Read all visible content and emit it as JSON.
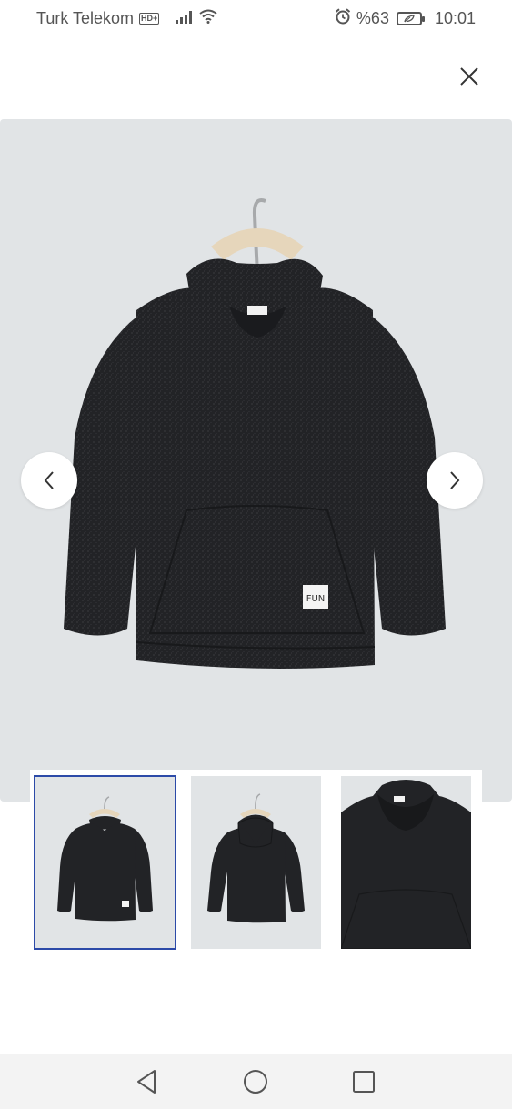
{
  "status_bar": {
    "carrier": "Turk Telekom",
    "hd_badge": "HD+",
    "battery_percent": "%63",
    "time": "10:01"
  },
  "header": {
    "close_icon": "close-icon"
  },
  "gallery": {
    "main_image": "product-photo-front",
    "patch_text": "FUN",
    "prev_icon": "chevron-left-icon",
    "next_icon": "chevron-right-icon",
    "thumbnails": [
      {
        "name": "front-view",
        "active": true
      },
      {
        "name": "back-view",
        "active": false
      },
      {
        "name": "closeup-view",
        "active": false
      }
    ],
    "accent_color": "#2c4aa8",
    "background_color": "#e1e4e6",
    "garment_color": "#222326"
  },
  "bottom_nav": {
    "back_icon": "back-triangle-icon",
    "home_icon": "home-circle-icon",
    "recents_icon": "recents-square-icon"
  }
}
